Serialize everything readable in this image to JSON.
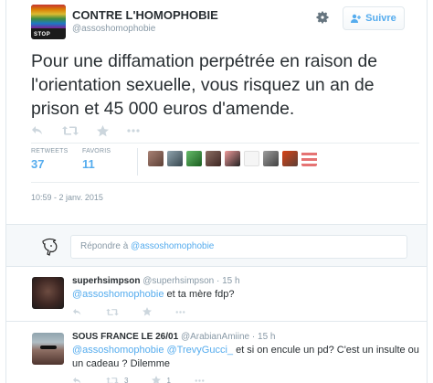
{
  "account": {
    "name": "CONTRE L'HOMOPHOBIE",
    "handle": "@assoshomophobie",
    "avatar_text": "STOP"
  },
  "follow_button": {
    "label": "Suivre"
  },
  "tweet": {
    "text": "Pour une diffamation perpétrée en raison de l'orientation sexuelle, vous risquez un an de prison et 45 000 euros d'amende.",
    "timestamp": "10:59 - 2 janv. 2015"
  },
  "stats": {
    "retweets_label": "RETWEETS",
    "retweets_value": "37",
    "favorites_label": "FAVORIS",
    "favorites_value": "11"
  },
  "colors": {
    "accent": "#55acee",
    "text": "#292f33",
    "muted": "#8899a6"
  },
  "reply_box": {
    "placeholder_prefix": "Répondre à ",
    "placeholder_mention": "@assoshomophobie"
  },
  "replies": [
    {
      "name": "superhsimpson",
      "handle": "@superhsimpson",
      "time": "15 h",
      "mention": "@assoshomophobie",
      "text": " et ta mère fdp?"
    },
    {
      "name": "SOUS FRANCE LE 26/01",
      "handle": "@ArabianAmiine",
      "time": "15 h",
      "mention": "@assoshomophobie",
      "mention2": "@TrevyGucci_",
      "text": " et si on encule un pd? C'est un insulte ou un cadeau ? Dilemme",
      "retweets": "3",
      "favorites": "1"
    }
  ]
}
